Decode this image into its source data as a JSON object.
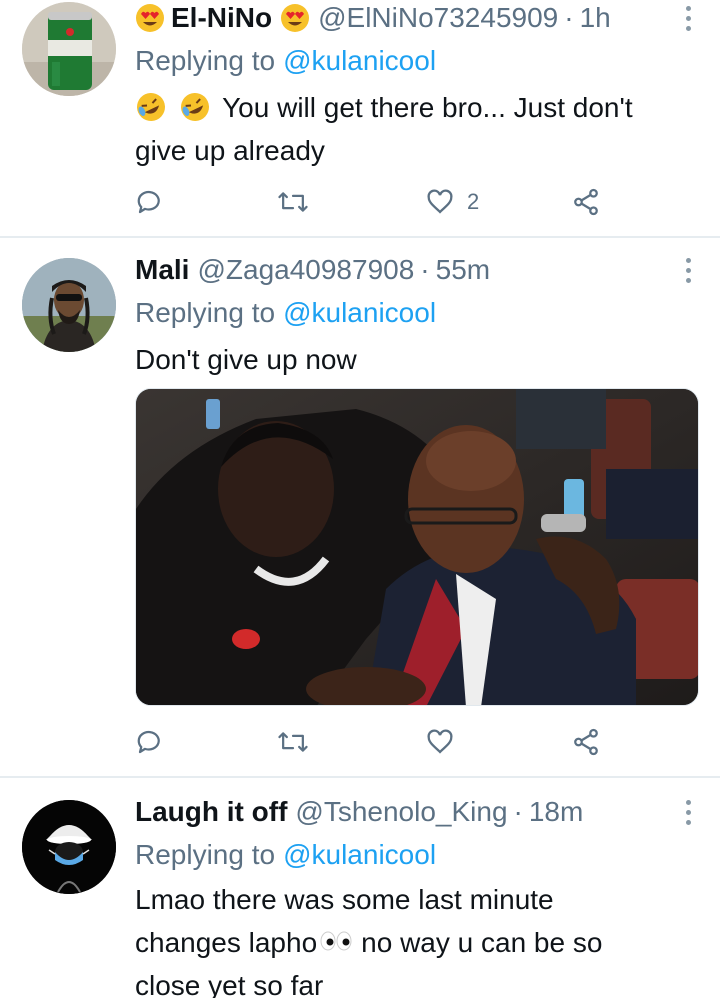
{
  "tweets": [
    {
      "display_name": "El-NiNo",
      "handle": "@ElNiNo73245909",
      "separator": "·",
      "time": "1h",
      "replying_label": "Replying to",
      "replying_to": "@kulanicool",
      "text_line1": "You will get there bro... Just don't",
      "text_line2": "give up already",
      "reply_count": "",
      "retweet_count": "",
      "like_count": "2",
      "avatar_label": "Heineken"
    },
    {
      "display_name": "Mali",
      "handle": "@Zaga40987908",
      "separator": "·",
      "time": "55m",
      "replying_label": "Replying to",
      "replying_to": "@kulanicool",
      "text_line1": "Don't give up now",
      "reply_count": "",
      "retweet_count": "",
      "like_count": ""
    },
    {
      "display_name": "Laugh it off",
      "handle": "@Tshenolo_King",
      "separator": "·",
      "time": "18m",
      "replying_label": "Replying to",
      "replying_to": "@kulanicool",
      "text_line1": "Lmao there was some last minute",
      "text_line2a": "changes lapho",
      "text_line2b": "no way u can be so",
      "text_line3": "close yet so far"
    }
  ],
  "icons": {
    "reply": "reply-icon",
    "retweet": "retweet-icon",
    "like": "heart-icon",
    "share": "share-icon",
    "more": "more-options-icon"
  },
  "colors": {
    "icon_gray": "#5b7083",
    "mention_blue": "#1da1f2",
    "divider": "#e6ecf0"
  }
}
